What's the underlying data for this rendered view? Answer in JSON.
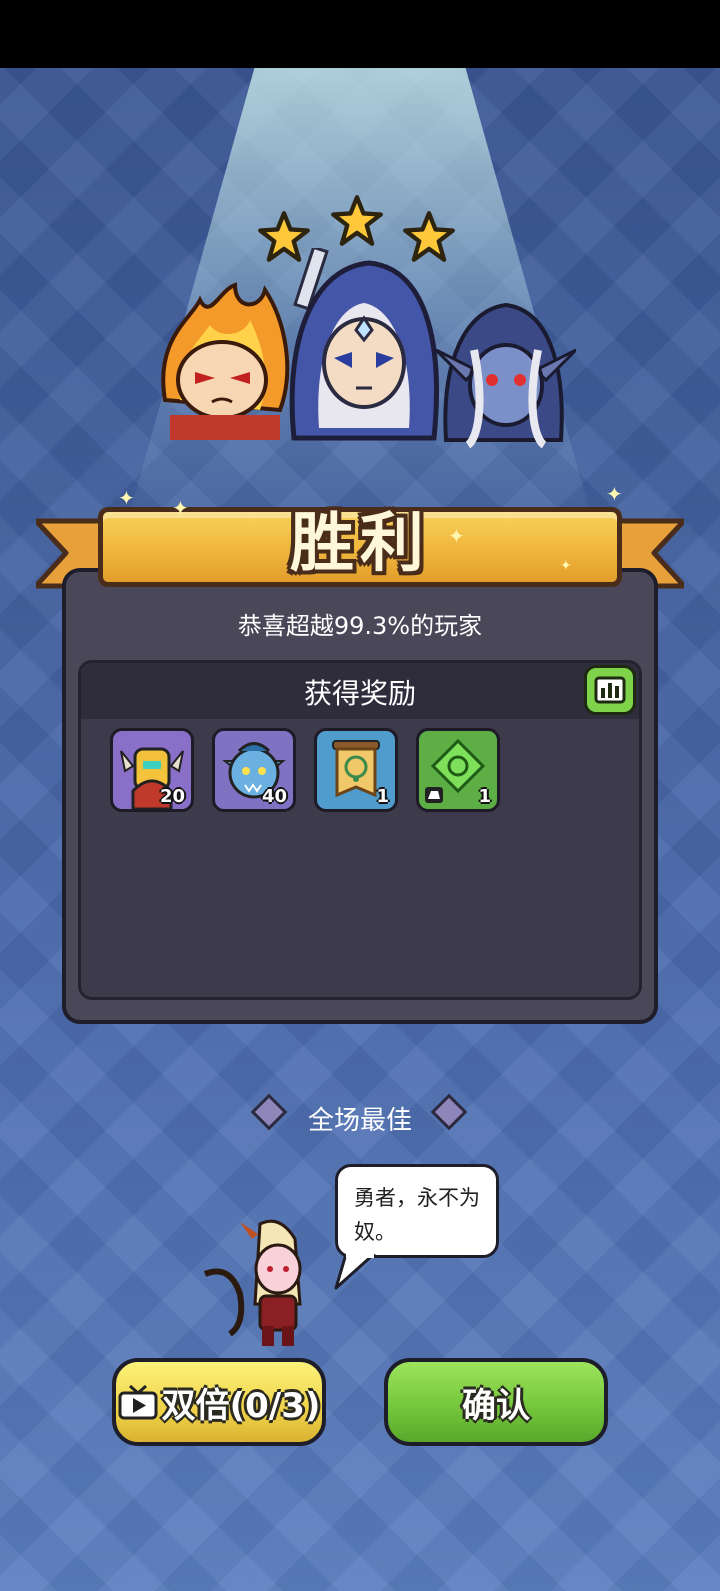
{
  "result": {
    "title": "胜利",
    "stars": 3,
    "subtitle": "恭喜超越99.3%的玩家"
  },
  "rewards": {
    "header": "获得奖励",
    "items": [
      {
        "icon": "armored-warrior-hero-shard",
        "count": "20"
      },
      {
        "icon": "blue-troll-hero-shard",
        "count": "40"
      },
      {
        "icon": "amulet-banner-item",
        "count": "1"
      },
      {
        "icon": "green-gem-item",
        "count": "1"
      }
    ]
  },
  "mvp": {
    "label": "全场最佳",
    "quote_line1": "勇者，永不为",
    "quote_line2": "奴。"
  },
  "buttons": {
    "double": "双倍(0/3)",
    "confirm": "确认"
  },
  "colors": {
    "banner": "#efb53c",
    "confirm": "#72c43a",
    "double": "#f0d24a"
  }
}
